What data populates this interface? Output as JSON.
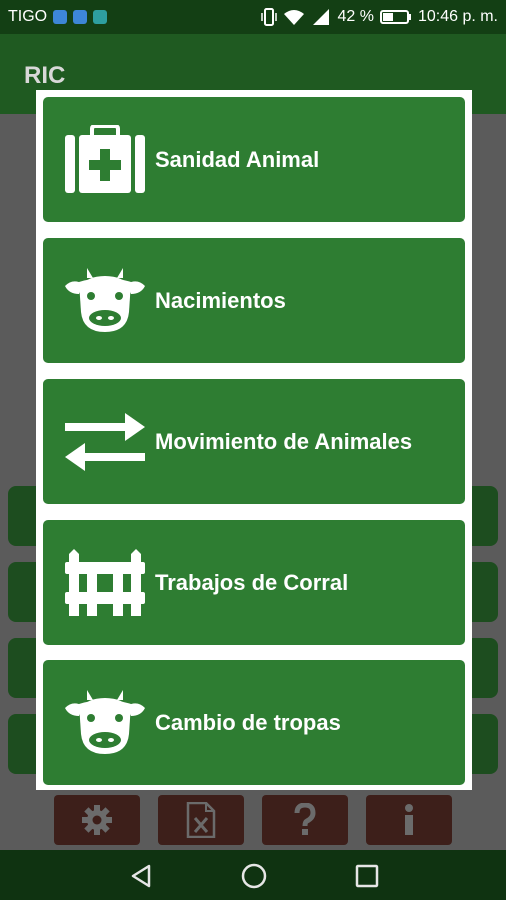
{
  "status_bar": {
    "carrier": "TIGO",
    "battery": "42 %",
    "time": "10:46 p. m."
  },
  "app": {
    "title": "RIC"
  },
  "menu": {
    "items": [
      {
        "label": "Sanidad Animal",
        "icon": "first-aid-kit-icon"
      },
      {
        "label": "Nacimientos",
        "icon": "cow-head-icon"
      },
      {
        "label": "Movimiento de Animales",
        "icon": "swap-arrows-icon"
      },
      {
        "label": "Trabajos de Corral",
        "icon": "fence-icon"
      },
      {
        "label": "Cambio de tropas",
        "icon": "cow-head-icon"
      }
    ]
  },
  "toolbar": {
    "icons": [
      "gear-icon",
      "excel-file-icon",
      "help-icon",
      "info-icon"
    ]
  },
  "colors": {
    "button_green": "#2e7d32",
    "appbar": "#1f5a21",
    "statusbar": "#133f14",
    "toolbar_button": "#3d1f1a"
  }
}
